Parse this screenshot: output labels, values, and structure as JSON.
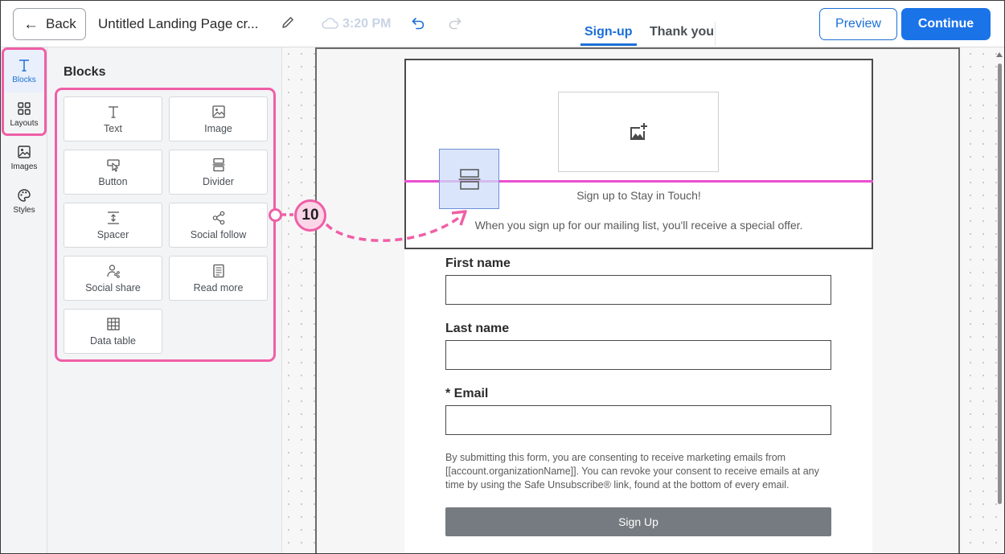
{
  "topbar": {
    "back_label": "Back",
    "title": "Untitled Landing Page cr...",
    "save_time": "3:20 PM",
    "tabs": [
      {
        "label": "Sign-up",
        "active": true
      },
      {
        "label": "Thank you",
        "active": false
      }
    ],
    "preview_label": "Preview",
    "continue_label": "Continue"
  },
  "rail": {
    "items": [
      {
        "label": "Blocks",
        "icon": "text-t-icon"
      },
      {
        "label": "Layouts",
        "icon": "grid-icon"
      },
      {
        "label": "Images",
        "icon": "image-icon"
      },
      {
        "label": "Styles",
        "icon": "palette-icon"
      }
    ]
  },
  "panel": {
    "title": "Blocks",
    "blocks": [
      {
        "label": "Text",
        "icon": "text-t-icon"
      },
      {
        "label": "Image",
        "icon": "image-icon"
      },
      {
        "label": "Button",
        "icon": "cursor-button-icon"
      },
      {
        "label": "Divider",
        "icon": "divider-icon"
      },
      {
        "label": "Spacer",
        "icon": "spacer-icon"
      },
      {
        "label": "Social follow",
        "icon": "share-icon"
      },
      {
        "label": "Social share",
        "icon": "user-share-icon"
      },
      {
        "label": "Read more",
        "icon": "document-icon"
      },
      {
        "label": "Data table",
        "icon": "table-icon"
      }
    ]
  },
  "canvas": {
    "header_heading": "Sign up to Stay in Touch!",
    "header_sub": "When you sign up for our mailing list, you'll receive a special offer.",
    "fields": [
      {
        "label": "First name"
      },
      {
        "label": "Last name"
      },
      {
        "label": "* Email"
      }
    ],
    "consent": "By submitting this form, you are consenting to receive marketing emails from [[account.organizationName]]. You can revoke your consent to receive emails at any time by using the Safe Unsubscribe® link, found at the bottom of every email.",
    "signup_label": "Sign Up"
  },
  "callout": {
    "number": "10"
  },
  "colors": {
    "accent": "#1b73e8",
    "highlight": "#ef5fa7",
    "drop_line": "#e94fd1"
  }
}
